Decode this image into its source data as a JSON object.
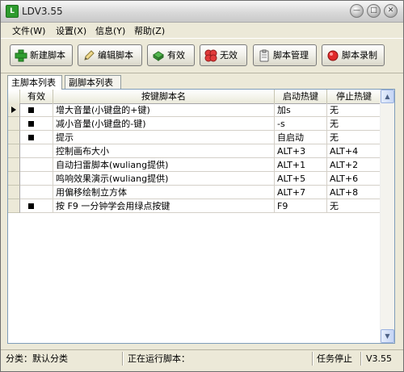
{
  "window": {
    "title": "LDV3.55"
  },
  "menu": [
    {
      "label": "文件(W)"
    },
    {
      "label": "设置(X)"
    },
    {
      "label": "信息(Y)"
    },
    {
      "label": "帮助(Z)"
    }
  ],
  "toolbar": {
    "buttons": [
      {
        "label": "新建脚本",
        "icon": "plus-icon"
      },
      {
        "label": "编辑脚本",
        "icon": "pencil-icon"
      },
      {
        "label": "有效",
        "icon": "check-icon"
      },
      {
        "label": "无效",
        "icon": "cross-icon"
      },
      {
        "label": "脚本管理",
        "icon": "clipboard-icon"
      },
      {
        "label": "脚本录制",
        "icon": "record-icon"
      }
    ]
  },
  "tabs": [
    {
      "label": "主脚本列表",
      "active": true
    },
    {
      "label": "副脚本列表",
      "active": false
    }
  ],
  "table": {
    "columns": [
      "有效",
      "按键脚本名",
      "启动热键",
      "停止热键"
    ],
    "rows": [
      {
        "valid": true,
        "name": "增大音量(小键盘的+键)",
        "start": "加s",
        "stop": "无",
        "current": true
      },
      {
        "valid": true,
        "name": "减小音量(小键盘的-键)",
        "start": "-s",
        "stop": "无"
      },
      {
        "valid": true,
        "name": "提示",
        "start": "自启动",
        "stop": "无"
      },
      {
        "valid": false,
        "name": "控制画布大小",
        "start": "ALT+3",
        "stop": "ALT+4"
      },
      {
        "valid": false,
        "name": "自动扫雷脚本(wuliang提供)",
        "start": "ALT+1",
        "stop": "ALT+2"
      },
      {
        "valid": false,
        "name": "鸣响效果演示(wuliang提供)",
        "start": "ALT+5",
        "stop": "ALT+6"
      },
      {
        "valid": false,
        "name": "用偏移绘制立方体",
        "start": "ALT+7",
        "stop": "ALT+8"
      },
      {
        "valid": true,
        "name": "按 F9 一分钟学会用绿点按键",
        "start": "F9",
        "stop": "无"
      }
    ]
  },
  "status": {
    "category": "分类：默认分类",
    "running": "正在运行脚本：",
    "task": "任务停止",
    "version": "V3.55"
  }
}
